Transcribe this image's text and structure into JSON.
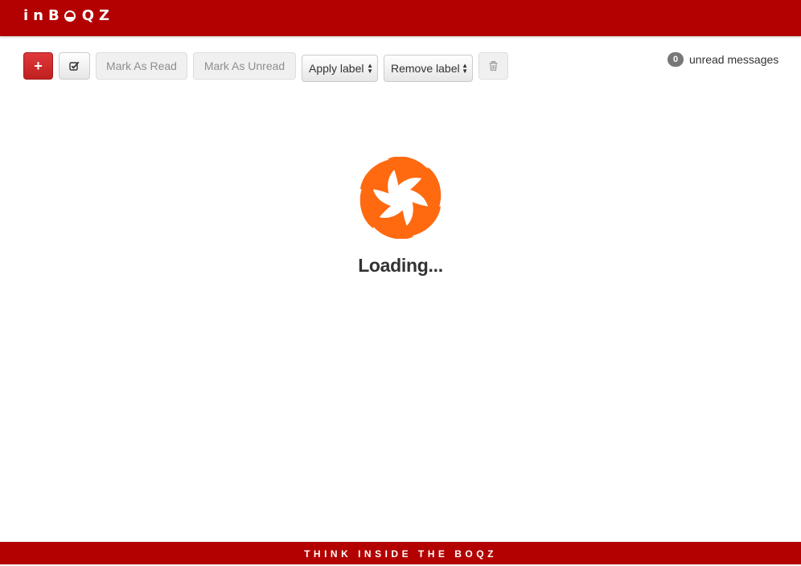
{
  "header": {
    "brand_part1": "inB",
    "brand_part2": "QZ",
    "brand_color": "#b30000"
  },
  "toolbar": {
    "new_icon": "plus-icon",
    "new_label": "+",
    "select_icon": "checkbox-icon",
    "mark_read_label": "Mark As Read",
    "mark_unread_label": "Mark As Unread",
    "apply_label": "Apply label",
    "remove_label": "Remove label",
    "trash_icon": "trash-icon"
  },
  "unread": {
    "count": "0",
    "label": "unread messages"
  },
  "main": {
    "spinner_icon": "loading-spinner-icon",
    "spinner_color": "#ff6a10",
    "loading_text": "Loading..."
  },
  "footer": {
    "tagline": "THINK INSIDE THE BOQZ"
  }
}
